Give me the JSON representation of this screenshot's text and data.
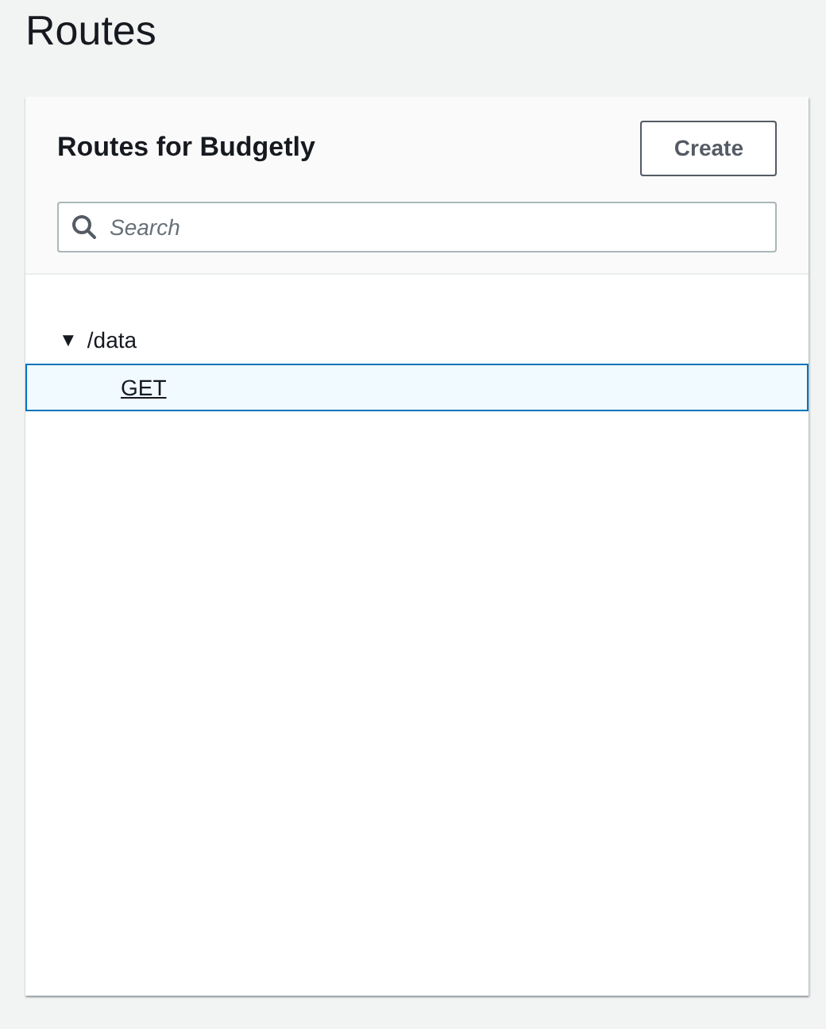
{
  "page_title": "Routes",
  "panel": {
    "title": "Routes for Budgetly",
    "create_button": "Create",
    "search": {
      "placeholder": "Search"
    }
  },
  "tree": [
    {
      "label": "/data",
      "expander": "▼",
      "expanded": true,
      "selected": false,
      "children": [
        {
          "label": "GET",
          "selected": true
        }
      ]
    }
  ]
}
